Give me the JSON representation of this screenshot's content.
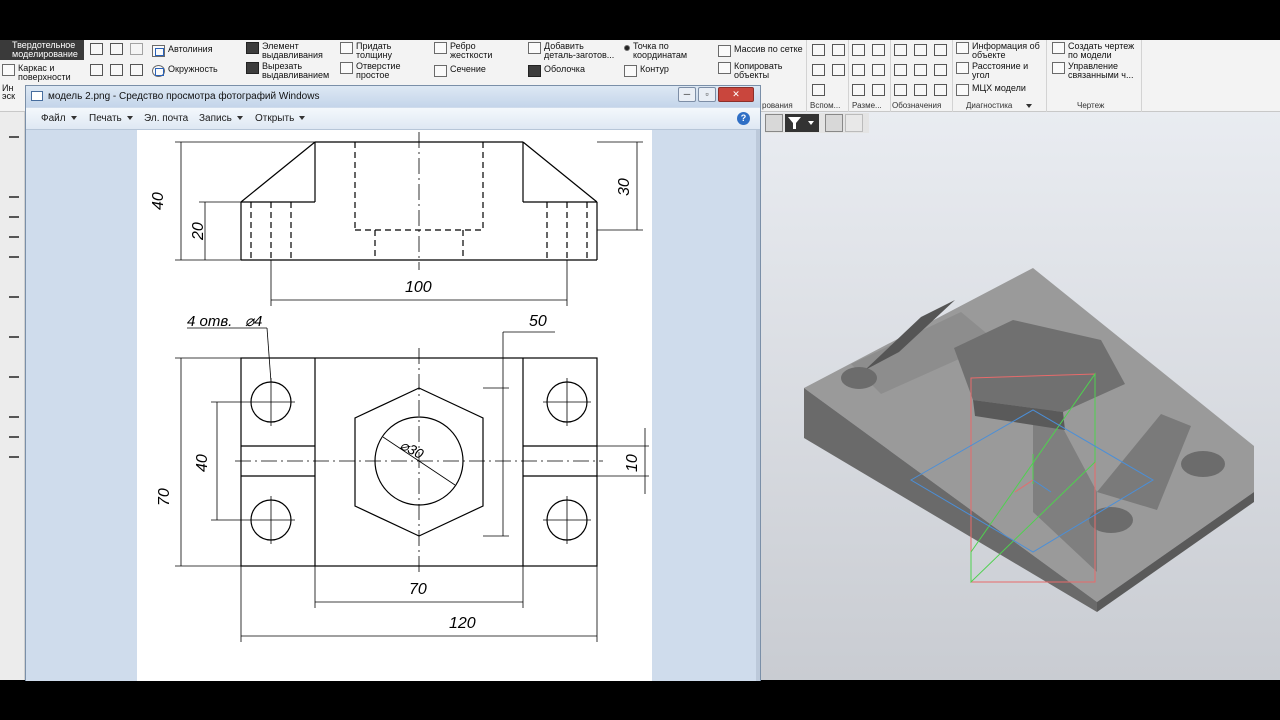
{
  "ribbon": {
    "tab_active": "Твердотельное моделирование",
    "tab_items": [
      "Каркас и поверхности",
      "Ин",
      "эск"
    ],
    "buttons": {
      "autoline": "Автолиния",
      "circle": "Окружность",
      "extrude_element": "Элемент выдавливания",
      "cut_extrude": "Вырезать выдавливанием",
      "add_thickness": "Придать толщину",
      "simple_hole": "Отверстие простое",
      "rib": "Ребро жесткости",
      "section": "Сечение",
      "add_part": "Добавить деталь-заготов...",
      "shell": "Оболочка",
      "point_by_coords": "Точка по координатам",
      "contour": "Контур",
      "grid_array": "Массив по сетке",
      "copy_objects": "Копировать объекты",
      "info_object": "Информация об объекте",
      "distance_angle": "Расстояние и угол",
      "mass_props": "МЦХ модели",
      "create_drawing": "Создать чертеж по модели",
      "manage_linked": "Управление связанными ч..."
    },
    "groups": {
      "aux": "Вспом...",
      "dims": "Разме...",
      "notation": "Обозначения",
      "diagnostics": "Диагностика",
      "drawing": "Чертеж",
      "partial": "рования"
    }
  },
  "viewer": {
    "title": "модель 2.png - Средство просмотра фотографий Windows",
    "menu": [
      "Файл",
      "Печать",
      "Эл. почта",
      "Запись",
      "Открыть"
    ],
    "help": "?"
  },
  "drawing": {
    "dims": {
      "h40": "40",
      "h20": "20",
      "h30": "30",
      "w100": "100",
      "holes_note": "4 отв.",
      "hole_dia": "⌀4",
      "d50": "50",
      "v40": "40",
      "v70": "70",
      "dia30": "⌀30",
      "v10": "10",
      "w70": "70",
      "w120": "120"
    }
  },
  "colors": {
    "ribbon_bg": "#f3f3f3",
    "viewer_chrome": "#cfdcec",
    "viewport_top": "#e9ecf1",
    "viewport_bottom": "#c9ccd2",
    "model_gray": "#8c8c8c"
  }
}
